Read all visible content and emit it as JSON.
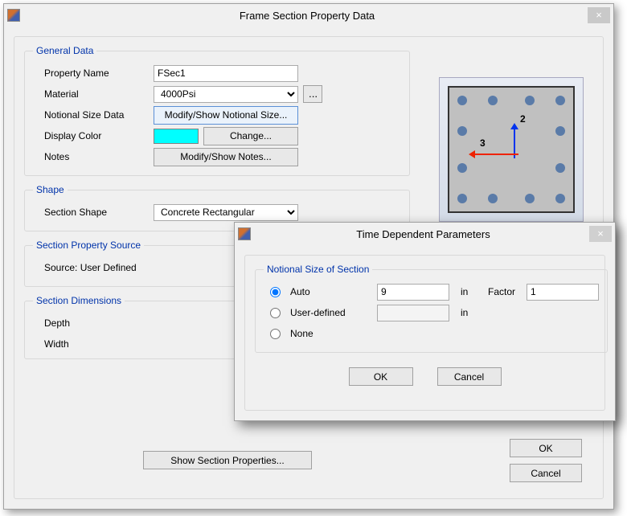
{
  "main": {
    "title": "Frame Section Property Data",
    "general": {
      "legend": "General Data",
      "property_name_label": "Property Name",
      "property_name_value": "FSec1",
      "material_label": "Material",
      "material_value": "4000Psi",
      "notional_label": "Notional Size Data",
      "notional_button": "Modify/Show Notional Size...",
      "display_color_label": "Display Color",
      "change_button": "Change...",
      "notes_label": "Notes",
      "notes_button": "Modify/Show Notes...",
      "ellipsis": "..."
    },
    "shape": {
      "legend": "Shape",
      "label": "Section Shape",
      "value": "Concrete Rectangular"
    },
    "source": {
      "legend": "Section Property Source",
      "text": "Source:  User Defined"
    },
    "dimensions": {
      "legend": "Section Dimensions",
      "depth_label": "Depth",
      "width_label": "Width"
    },
    "preview": {
      "axis2": "2",
      "axis3": "3"
    },
    "show_props": "Show Section Properties...",
    "ok": "OK",
    "cancel": "Cancel"
  },
  "sub": {
    "title": "Time Dependent Parameters",
    "group_legend": "Notional Size of Section",
    "auto_label": "Auto",
    "user_label": "User-defined",
    "none_label": "None",
    "auto_value": "9",
    "unit": "in",
    "factor_label": "Factor",
    "factor_value": "1",
    "user_value": "",
    "ok": "OK",
    "cancel": "Cancel"
  }
}
